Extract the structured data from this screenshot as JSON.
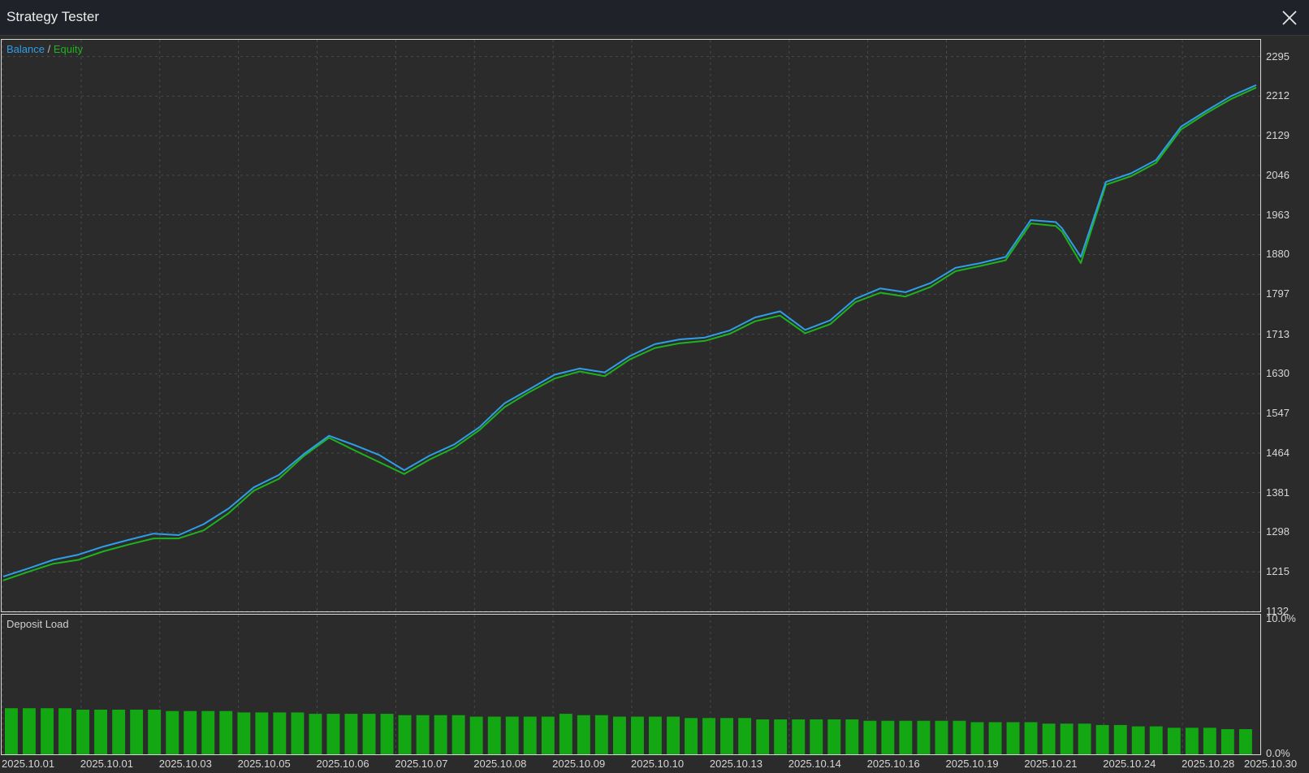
{
  "window": {
    "title": "Strategy Tester",
    "close_icon": "close-icon"
  },
  "legend": {
    "balance": "Balance",
    "separator": "/",
    "equity": "Equity"
  },
  "colors": {
    "balance": "#2f9ee8",
    "equity": "#1db31d",
    "deposit_load": "#13a713",
    "grid": "#4a4a4a",
    "background": "#2b2b2b"
  },
  "deposit_panel": {
    "title": "Deposit Load",
    "y_top": "10.0%",
    "y_bottom": "0.0%"
  },
  "chart_data": [
    {
      "type": "line",
      "title": "",
      "legend": [
        "Balance",
        "Equity"
      ],
      "y_ticks": [
        1132,
        1215,
        1298,
        1381,
        1464,
        1547,
        1630,
        1713,
        1797,
        1880,
        1963,
        2046,
        2129,
        2212,
        2295
      ],
      "ylim": [
        1132,
        2330
      ],
      "x_tick_labels": [
        "2025.10.01",
        "2025.10.01",
        "2025.10.03",
        "2025.10.05",
        "2025.10.06",
        "2025.10.07",
        "2025.10.08",
        "2025.10.09",
        "2025.10.10",
        "2025.10.13",
        "2025.10.14",
        "2025.10.16",
        "2025.10.19",
        "2025.10.21",
        "2025.10.24",
        "2025.10.28",
        "2025.10.30"
      ],
      "grid": true,
      "legend_position": "top-left",
      "x": [
        0,
        0.02,
        0.04,
        0.06,
        0.08,
        0.1,
        0.12,
        0.14,
        0.16,
        0.18,
        0.2,
        0.22,
        0.24,
        0.26,
        0.28,
        0.3,
        0.32,
        0.34,
        0.36,
        0.38,
        0.4,
        0.42,
        0.44,
        0.46,
        0.48,
        0.5,
        0.52,
        0.54,
        0.56,
        0.58,
        0.6,
        0.62,
        0.64,
        0.66,
        0.68,
        0.7,
        0.72,
        0.74,
        0.76,
        0.78,
        0.8,
        0.82,
        0.84,
        0.845,
        0.86,
        0.88,
        0.9,
        0.92,
        0.94,
        0.96,
        0.98,
        1.0
      ],
      "series": [
        {
          "name": "Balance",
          "values": [
            1205,
            1222,
            1240,
            1251,
            1268,
            1282,
            1295,
            1292,
            1315,
            1348,
            1392,
            1418,
            1462,
            1500,
            1481,
            1460,
            1428,
            1458,
            1482,
            1518,
            1568,
            1598,
            1628,
            1641,
            1633,
            1667,
            1692,
            1702,
            1706,
            1721,
            1748,
            1761,
            1722,
            1742,
            1787,
            1809,
            1801,
            1820,
            1852,
            1862,
            1875,
            1952,
            1948,
            1935,
            1875,
            2032,
            2050,
            2078,
            2148,
            2181,
            2212,
            2235,
            2242
          ]
        },
        {
          "name": "Equity",
          "values": [
            1197,
            1215,
            1232,
            1240,
            1258,
            1272,
            1285,
            1285,
            1302,
            1338,
            1385,
            1410,
            1458,
            1496,
            1470,
            1445,
            1420,
            1450,
            1475,
            1512,
            1560,
            1592,
            1620,
            1635,
            1625,
            1660,
            1684,
            1694,
            1699,
            1714,
            1740,
            1752,
            1715,
            1734,
            1780,
            1800,
            1792,
            1812,
            1845,
            1856,
            1868,
            1945,
            1940,
            1928,
            1862,
            2026,
            2044,
            2072,
            2142,
            2176,
            2206,
            2230,
            2238
          ]
        }
      ]
    },
    {
      "type": "bar",
      "title": "Deposit Load",
      "ylim": [
        0,
        10
      ],
      "y_tick_labels": [
        "10.0%",
        "0.0%"
      ],
      "grid": true,
      "series": [
        {
          "name": "Deposit Load",
          "values": [
            3.3,
            3.3,
            3.3,
            3.3,
            3.2,
            3.2,
            3.2,
            3.2,
            3.2,
            3.1,
            3.1,
            3.1,
            3.1,
            3.0,
            3.0,
            3.0,
            3.0,
            2.9,
            2.9,
            2.9,
            2.9,
            2.9,
            2.8,
            2.8,
            2.8,
            2.8,
            2.7,
            2.7,
            2.7,
            2.7,
            2.7,
            2.9,
            2.8,
            2.8,
            2.7,
            2.7,
            2.7,
            2.7,
            2.6,
            2.6,
            2.6,
            2.6,
            2.5,
            2.5,
            2.5,
            2.5,
            2.5,
            2.5,
            2.4,
            2.4,
            2.4,
            2.4,
            2.4,
            2.4,
            2.3,
            2.3,
            2.3,
            2.3,
            2.2,
            2.2,
            2.2,
            2.1,
            2.1,
            2.0,
            2.0,
            1.9,
            1.9,
            1.9,
            1.8,
            1.8
          ]
        }
      ]
    }
  ]
}
